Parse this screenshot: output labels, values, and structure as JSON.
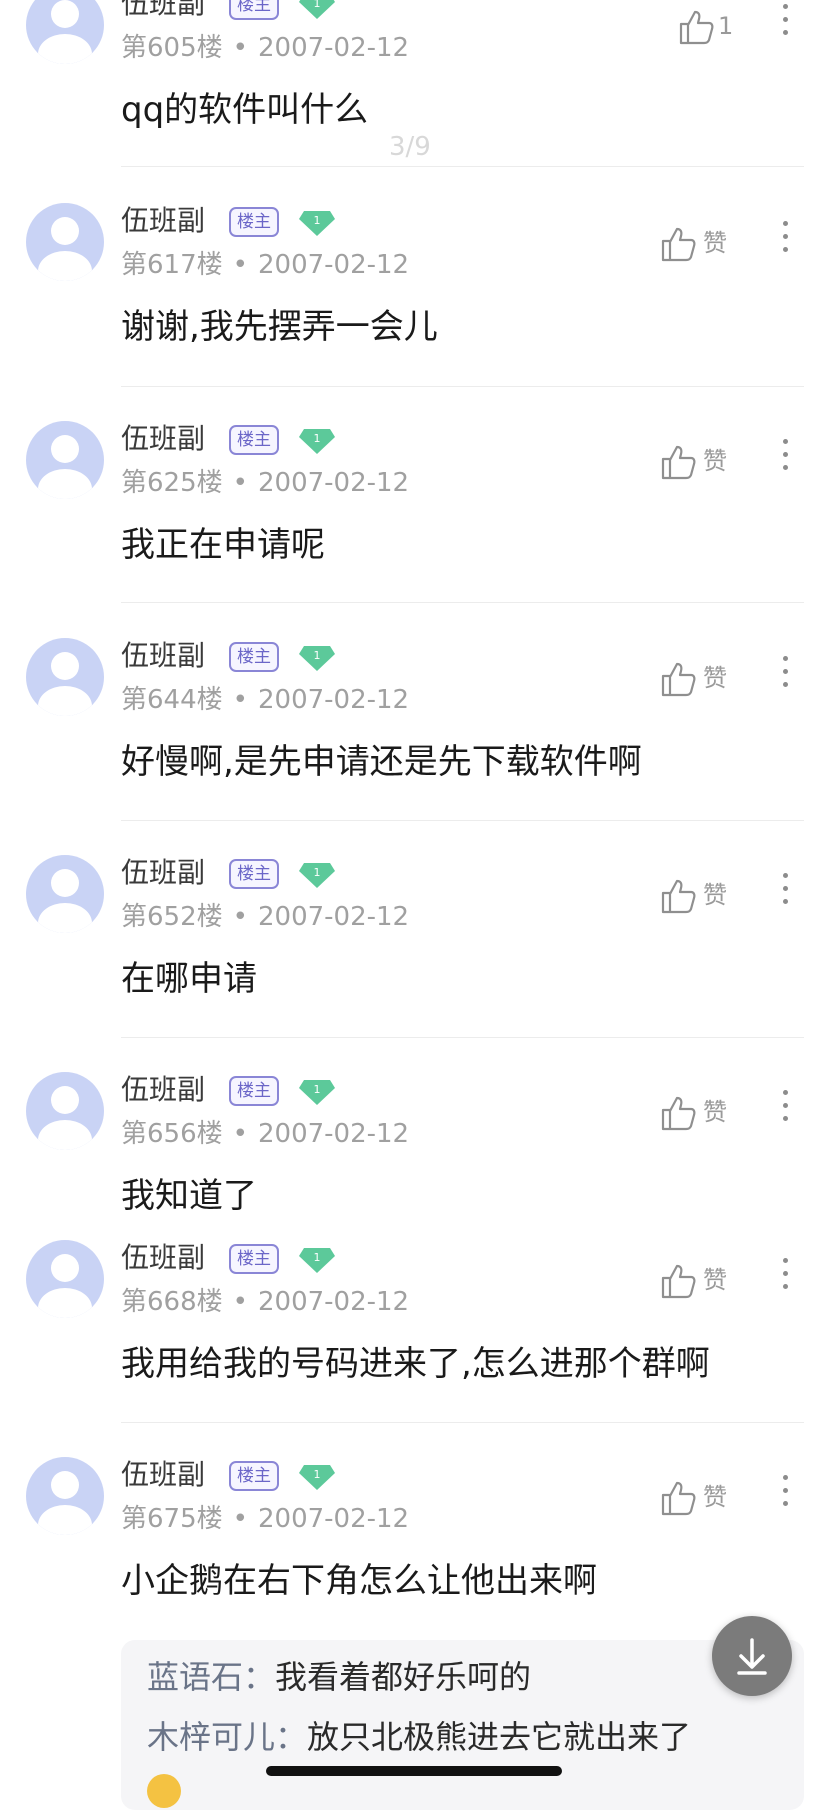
{
  "page_indicator": "3/9",
  "op_badge": "楼主",
  "level": "1",
  "posts": [
    {
      "user": "伍班副",
      "floor": "第605楼",
      "date": "2007-02-12",
      "likes": "1",
      "content": "qq的软件叫什么"
    },
    {
      "user": "伍班副",
      "floor": "第617楼",
      "date": "2007-02-12",
      "likes": "赞",
      "content": "谢谢,我先摆弄一会儿"
    },
    {
      "user": "伍班副",
      "floor": "第625楼",
      "date": "2007-02-12",
      "likes": "赞",
      "content": "我正在申请呢"
    },
    {
      "user": "伍班副",
      "floor": "第644楼",
      "date": "2007-02-12",
      "likes": "赞",
      "content": "好慢啊,是先申请还是先下载软件啊"
    },
    {
      "user": "伍班副",
      "floor": "第652楼",
      "date": "2007-02-12",
      "likes": "赞",
      "content": "在哪申请"
    },
    {
      "user": "伍班副",
      "floor": "第656楼",
      "date": "2007-02-12",
      "likes": "赞",
      "content": "我知道了"
    },
    {
      "user": "伍班副",
      "floor": "第668楼",
      "date": "2007-02-12",
      "likes": "赞",
      "content": "我用给我的号码进来了,怎么进那个群啊"
    },
    {
      "user": "伍班副",
      "floor": "第675楼",
      "date": "2007-02-12",
      "likes": "赞",
      "content": "小企鹅在右下角怎么让他出来啊"
    }
  ],
  "sub_replies": [
    {
      "user": "蓝语石",
      "sep": "：",
      "text": "我看着都好乐呵的"
    },
    {
      "user": "木梓可儿",
      "sep": "：",
      "text": "放只北极熊进去它就出来了"
    }
  ],
  "colors": {
    "avatar": "#c9d3f5",
    "badge": "#6b66c8",
    "level_gem": "#5cc99a",
    "download_button": "#7b7b7b"
  }
}
